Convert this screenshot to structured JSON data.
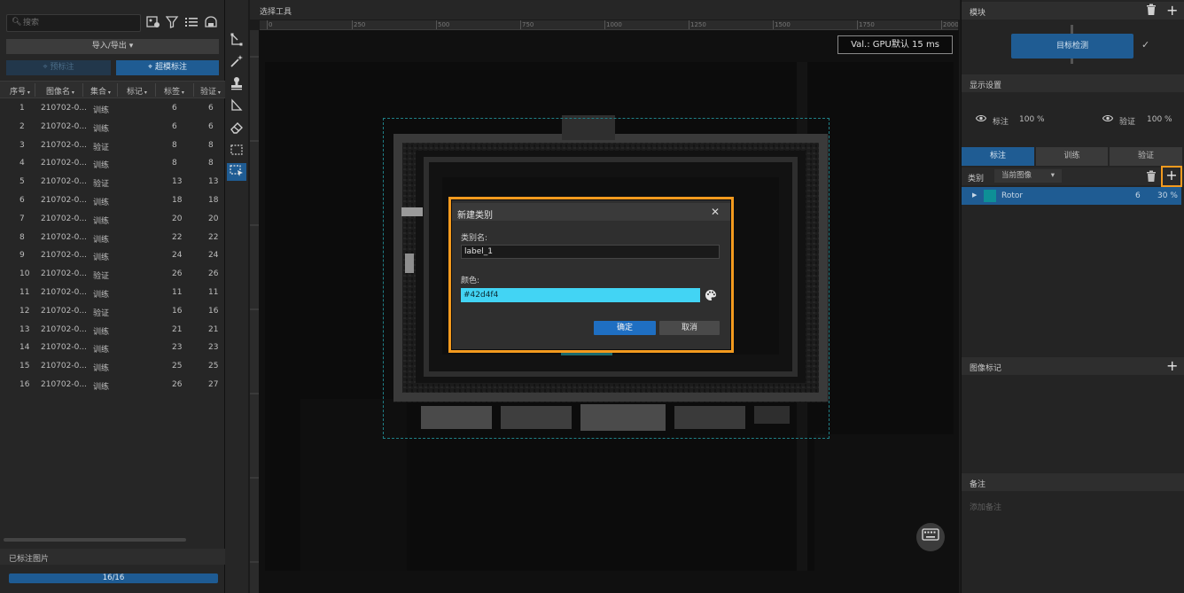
{
  "left_panel": {
    "search_placeholder": "搜索",
    "import_export_label": "导入/导出",
    "prelabel_label": "预标注",
    "superlabel_label": "超模标注",
    "columns": [
      "序号",
      "图像名",
      "集合",
      "标记",
      "标签",
      "验证"
    ],
    "rows": [
      [
        "1",
        "210702-0...",
        "训练",
        "",
        "6",
        "6"
      ],
      [
        "2",
        "210702-0...",
        "训练",
        "",
        "6",
        "6"
      ],
      [
        "3",
        "210702-0...",
        "验证",
        "",
        "8",
        "8"
      ],
      [
        "4",
        "210702-0...",
        "训练",
        "",
        "8",
        "8"
      ],
      [
        "5",
        "210702-0...",
        "验证",
        "",
        "13",
        "13"
      ],
      [
        "6",
        "210702-0...",
        "训练",
        "",
        "18",
        "18"
      ],
      [
        "7",
        "210702-0...",
        "训练",
        "",
        "20",
        "20"
      ],
      [
        "8",
        "210702-0...",
        "训练",
        "",
        "22",
        "22"
      ],
      [
        "9",
        "210702-0...",
        "训练",
        "",
        "24",
        "24"
      ],
      [
        "10",
        "210702-0...",
        "验证",
        "",
        "26",
        "26"
      ],
      [
        "11",
        "210702-0...",
        "训练",
        "",
        "11",
        "11"
      ],
      [
        "12",
        "210702-0...",
        "验证",
        "",
        "16",
        "16"
      ],
      [
        "13",
        "210702-0...",
        "训练",
        "",
        "21",
        "21"
      ],
      [
        "14",
        "210702-0...",
        "训练",
        "",
        "23",
        "23"
      ],
      [
        "15",
        "210702-0...",
        "训练",
        "",
        "25",
        "25"
      ],
      [
        "16",
        "210702-0...",
        "训练",
        "",
        "26",
        "27"
      ]
    ],
    "labeled_title": "已标注图片",
    "progress_text": "16/16",
    "progress_fraction": 1.0
  },
  "canvas": {
    "title": "选择工具",
    "ruler_ticks": [
      "0",
      "250",
      "500",
      "750",
      "1000",
      "1250",
      "1500",
      "1750",
      "2000"
    ],
    "val_text": "Val.: GPU默认 15 ms"
  },
  "dialog": {
    "title": "新建类别",
    "name_label": "类别名:",
    "name_value": "label_1",
    "color_label": "颜色:",
    "color_value": "#42d4f4",
    "ok_label": "确定",
    "cancel_label": "取消"
  },
  "right_panel": {
    "module_title": "模块",
    "module_button": "目标检测",
    "display_title": "显示设置",
    "display_label_text": "标注",
    "display_label_pct": "100 %",
    "display_verify_text": "验证",
    "display_verify_pct": "100 %",
    "tabs": [
      "标注",
      "训练",
      "验证"
    ],
    "class_label": "类别",
    "class_scope": "当前图像",
    "class_rows": [
      {
        "name": "Rotor",
        "count": "6",
        "percent": "30 %",
        "color": "#0e8f96"
      }
    ],
    "image_tags_title": "图像标记",
    "notes_title": "备注",
    "notes_placeholder": "添加备注"
  },
  "colors": {
    "accent_blue": "#1f5c93",
    "highlight_orange": "#f39a1e",
    "selected_color": "#42d4f4"
  }
}
